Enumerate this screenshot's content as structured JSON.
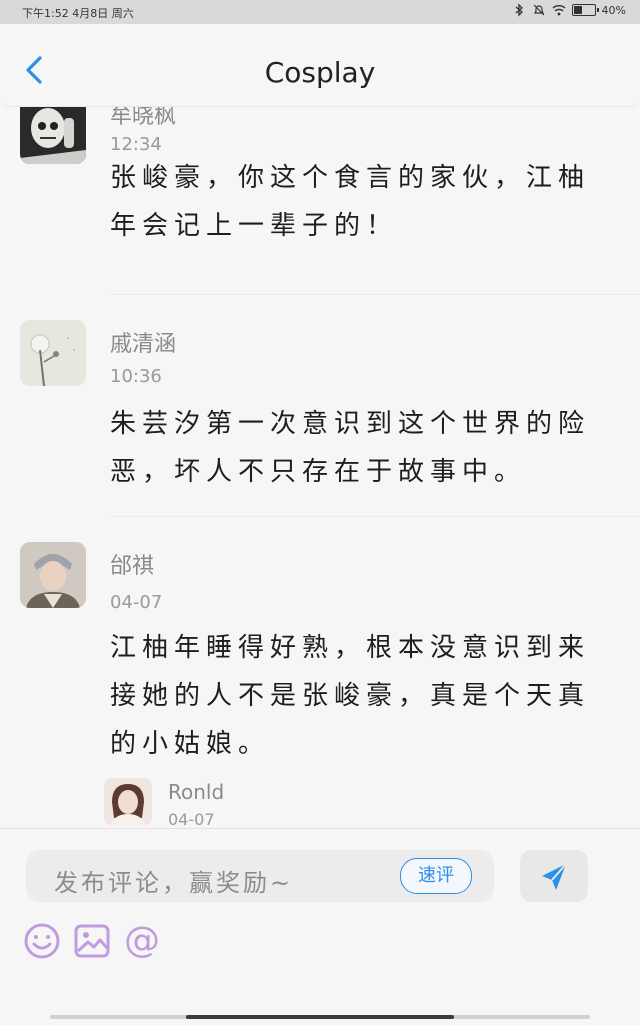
{
  "status": {
    "time_text": "下午1:52 4月8日 周六",
    "battery": "40%",
    "battery_level": 0.4
  },
  "header": {
    "title": "Cosplay"
  },
  "comments": [
    {
      "name": "牟晓枫",
      "time": "12:34",
      "text": "张峻豪，你这个食言的家伙，江柚年会记上一辈子的！"
    },
    {
      "name": "戚清涵",
      "time": "10:36",
      "text": "朱芸汐第一次意识到这个世界的险恶，坏人不只存在于故事中。"
    },
    {
      "name": "邰祺",
      "time": "04-07",
      "text": "江柚年睡得好熟，根本没意识到来接她的人不是张峻豪，真是个天真的小姑娘。"
    }
  ],
  "reply": {
    "name": "Ronld",
    "time": "04-07"
  },
  "composer": {
    "placeholder": "发布评论，赢奖励~",
    "quick_label": "速评"
  },
  "colors": {
    "accent": "#2c8fe8",
    "tool_purple": "#c19be0"
  }
}
